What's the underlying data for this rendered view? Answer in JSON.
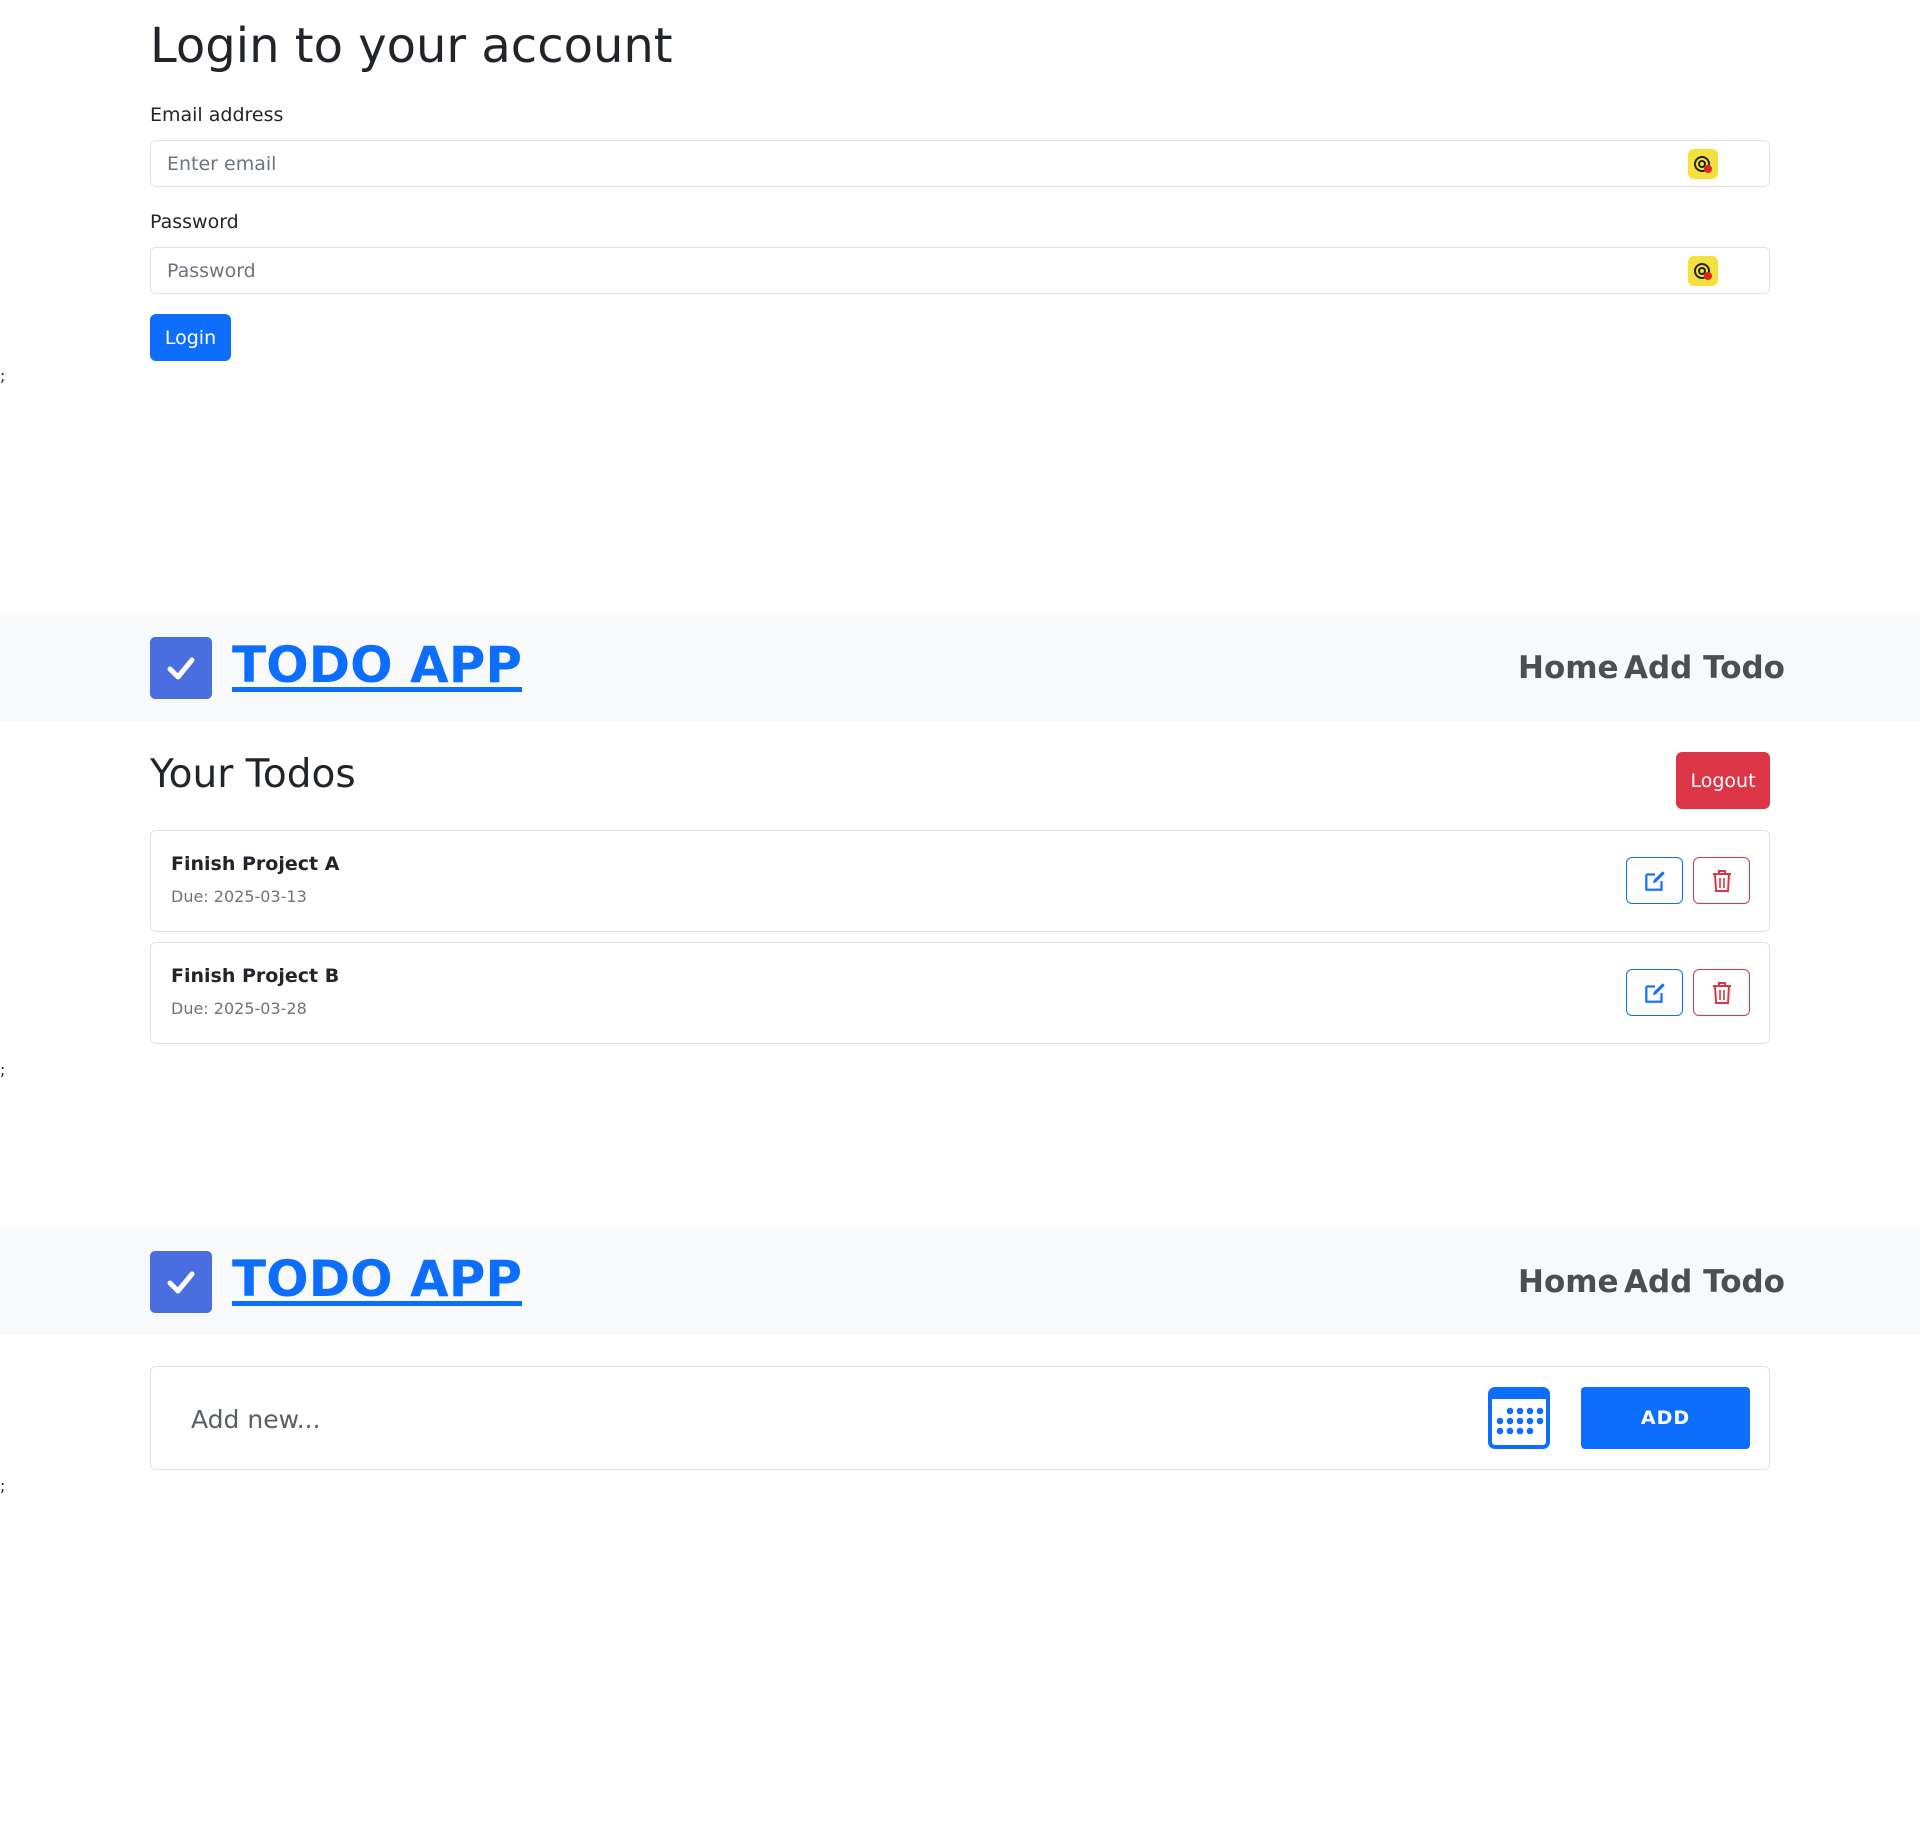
{
  "stray_text": ";",
  "login": {
    "title": "Login to your account",
    "email_label": "Email address",
    "email_placeholder": "Enter email",
    "password_label": "Password",
    "password_placeholder": "Password",
    "submit_label": "Login"
  },
  "navbar": {
    "brand": "TODO APP",
    "links": [
      "Home",
      "Add Todo"
    ]
  },
  "todos": {
    "title": "Your Todos",
    "logout_label": "Logout",
    "due_label": "Due:",
    "items": [
      {
        "title": "Finish Project A",
        "due": "2025-03-13"
      },
      {
        "title": "Finish Project B",
        "due": "2025-03-28"
      }
    ]
  },
  "add_todo": {
    "placeholder": "Add new...",
    "add_label": "ADD"
  },
  "colors": {
    "primary": "#0d6efd",
    "danger": "#dc3545",
    "brand_icon": "#4a6ee0",
    "navbar_bg": "#f8f9fa"
  },
  "icons": {
    "field_extension": "autofill-extension-icon",
    "brand": "checkbox-icon",
    "edit": "edit-icon",
    "delete": "trash-icon",
    "calendar": "calendar-icon"
  }
}
